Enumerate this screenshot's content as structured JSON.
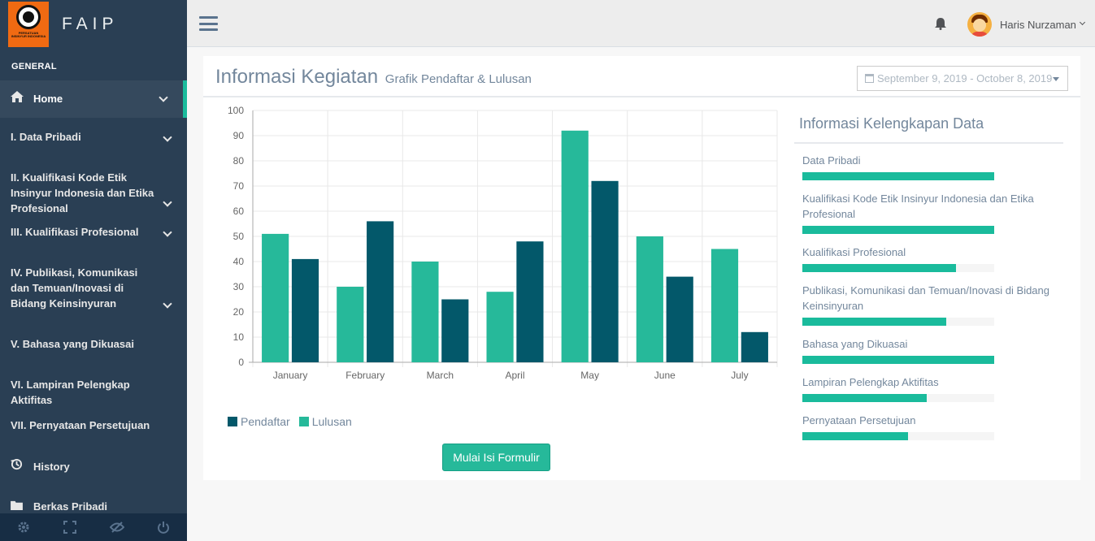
{
  "brand": {
    "name": "FAIP",
    "logo_text": "PERSATUAN INSINYUR INDONESIA"
  },
  "sidebar": {
    "section": "GENERAL",
    "items": [
      {
        "label": "Home",
        "icon": "home-icon",
        "chevron": true,
        "active": true
      },
      {
        "label": "I. Data Pribadi",
        "chevron": true
      },
      {
        "label": "II. Kualifikasi Kode Etik Insinyur Indonesia dan Etika Profesional",
        "chevron": true
      },
      {
        "label": "III. Kualifikasi Profesional",
        "chevron": true
      },
      {
        "label": "IV. Publikasi, Komunikasi dan Temuan/Inovasi di Bidang Keinsinyuran",
        "chevron": true
      },
      {
        "label": "V. Bahasa yang Dikuasai"
      },
      {
        "label": "VI. Lampiran Pelengkap Aktifitas"
      },
      {
        "label": "VII. Pernyataan Persetujuan"
      },
      {
        "label": "History",
        "icon": "history-icon"
      },
      {
        "label": "Berkas Pribadi",
        "icon": "folder-icon"
      }
    ],
    "footer": [
      "gear-icon",
      "fullscreen-icon",
      "eye-slash-icon",
      "power-icon"
    ]
  },
  "topnav": {
    "user_name": "Haris Nurzaman"
  },
  "panel": {
    "title": "Informasi Kegiatan",
    "subtitle": "Grafik Pendaftar & Lulusan",
    "date_range": "September 9, 2019 - October 8, 2019"
  },
  "chart_data": {
    "type": "bar",
    "categories": [
      "January",
      "February",
      "March",
      "April",
      "May",
      "June",
      "July"
    ],
    "series": [
      {
        "name": "Lulusan",
        "color": "#26B99A",
        "values": [
          51,
          30,
          40,
          28,
          92,
          50,
          45
        ]
      },
      {
        "name": "Pendaftar",
        "color": "#03586A",
        "values": [
          41,
          56,
          25,
          48,
          72,
          34,
          12
        ]
      }
    ],
    "ylim": [
      0,
      100
    ],
    "yticks": [
      0,
      10,
      20,
      30,
      40,
      50,
      60,
      70,
      80,
      90,
      100
    ],
    "grid": true,
    "legend": [
      "Pendaftar",
      "Lulusan"
    ],
    "legend_position": "bottom-left"
  },
  "start_button": "Mulai Isi Formulir",
  "completeness": {
    "title": "Informasi Kelengkapan Data",
    "items": [
      {
        "label": "Data Pribadi",
        "progress": 100
      },
      {
        "label": "Kualifikasi Kode Etik Insinyur Indonesia dan Etika Profesional",
        "progress": 100
      },
      {
        "label": "Kualifikasi Profesional",
        "progress": 80
      },
      {
        "label": "Publikasi, Komunikasi dan Temuan/Inovasi di Bidang Keinsinyuran",
        "progress": 75
      },
      {
        "label": "Bahasa yang Dikuasai",
        "progress": 100
      },
      {
        "label": "Lampiran Pelengkap Aktifitas",
        "progress": 65
      },
      {
        "label": "Pernyataan Persetujuan",
        "progress": 55
      }
    ]
  },
  "colors": {
    "accent": "#1ABB9C",
    "sidebar": "#2A3F54",
    "primary_bar": "#26B99A",
    "secondary_bar": "#03586A"
  }
}
